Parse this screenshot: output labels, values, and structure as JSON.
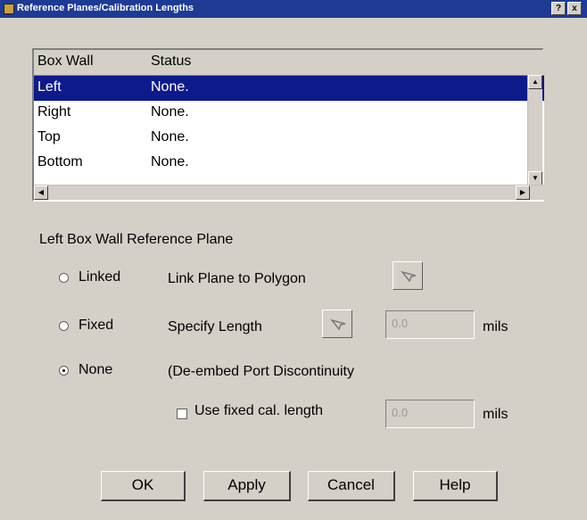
{
  "window": {
    "title": "Reference Planes/Calibration Lengths",
    "help_glyph": "?",
    "close_glyph": "x"
  },
  "list": {
    "columns": [
      "Box Wall",
      "Status"
    ],
    "rows": [
      {
        "wall": "Left",
        "status": "None."
      },
      {
        "wall": "Right",
        "status": "None."
      },
      {
        "wall": "Top",
        "status": "None."
      },
      {
        "wall": "Bottom",
        "status": "None."
      }
    ],
    "selected_index": 0
  },
  "section": {
    "title": "Left Box Wall Reference Plane"
  },
  "options": {
    "linked": {
      "label": "Linked",
      "checked": false,
      "description": "Link Plane to Polygon"
    },
    "fixed": {
      "label": "Fixed",
      "checked": false,
      "description": "Specify Length",
      "value": "0.0",
      "unit": "mils"
    },
    "none": {
      "label": "None",
      "checked": true,
      "description": "(De-embed Port Discontinuity"
    },
    "use_fixed": {
      "label": "Use fixed cal. length",
      "checked": false,
      "value": "0.0",
      "unit": "mils"
    }
  },
  "buttons": {
    "ok": "OK",
    "apply": "Apply",
    "cancel": "Cancel",
    "help": "Help"
  },
  "colors": {
    "titlebar": "#1e3a95",
    "selection": "#0d1a8c",
    "dialog": "#d4d0c8"
  },
  "icons": {
    "pick_polygon": "pointer-arrow-icon",
    "pick_length": "pointer-arrow-icon"
  }
}
